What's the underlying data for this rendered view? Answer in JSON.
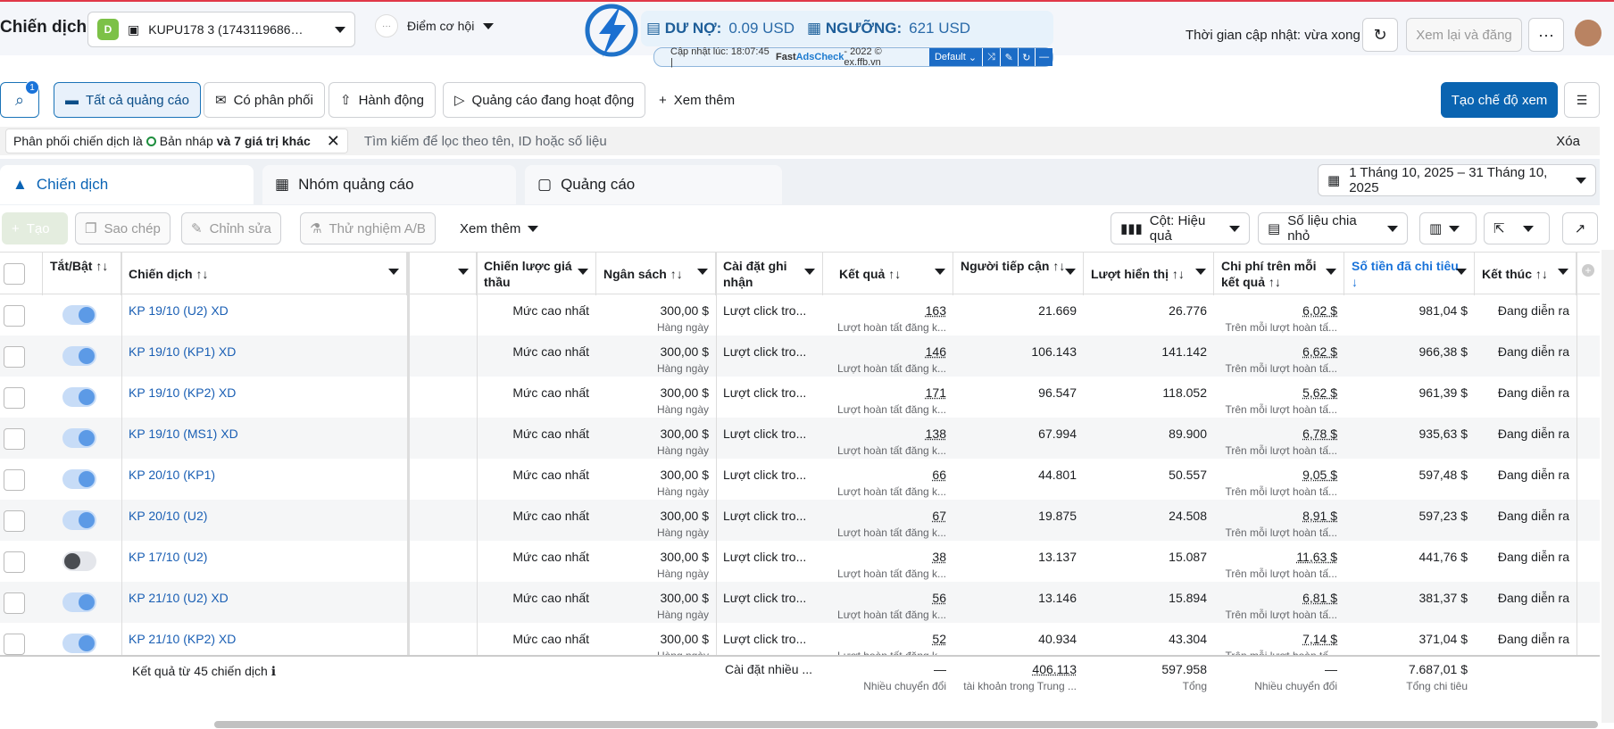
{
  "header": {
    "title": "Chiến dịch",
    "account_badge": "D",
    "account": "KUPU178 3 (1743119686…",
    "opportunity_dots": "···",
    "opportunity": "Điểm cơ hội",
    "update_text": "Thời gian cập nhật: vừa xong",
    "review": "Xem lại và đăng",
    "more": "···"
  },
  "extension": {
    "debt_label": "DƯ NỢ:",
    "debt": "0.09 USD",
    "threshold_label": "NGƯỠNG:",
    "threshold": "621 USD",
    "update_time": "Cập nhật lúc: 18:07:45 | ",
    "brand_fast": "Fast ",
    "brand_ads": "AdsCheck",
    "brand_rest": " - 2022 © ex.ffb.vn",
    "mode": "Default"
  },
  "filters": {
    "search_badge": "1",
    "all_ads": "Tất cả quảng cáo",
    "delivered": "Có phân phối",
    "actions": "Hành động",
    "active_ads": "Quảng cáo đang hoạt động",
    "see_more": "Xem thêm",
    "create_view": "Tạo chế độ xem"
  },
  "filter_bar": {
    "chip_prefix": "Phân phối chiến dịch là",
    "chip_value": "Bản nháp",
    "chip_more": "và 7 giá trị khác",
    "search_placeholder": "Tìm kiếm để lọc theo tên, ID hoặc số liệu",
    "clear": "Xóa"
  },
  "tabs": [
    "Chiến dịch",
    "Nhóm quảng cáo",
    "Quảng cáo"
  ],
  "date_range": "1 Tháng 10, 2025 – 31 Tháng 10, 2025",
  "toolbar": {
    "create": "Tạo",
    "copy": "Sao chép",
    "edit": "Chỉnh sửa",
    "ab_test": "Thử nghiệm A/B",
    "more": "Xem thêm",
    "columns": "Cột: Hiệu quả",
    "breakdown": "Số liệu chia nhỏ"
  },
  "columns": {
    "toggle": "Tắt/Bật ↑↓",
    "campaign": "Chiến dịch ↑↓",
    "bid": "Chiến lược giá thầu",
    "budget": "Ngân sách ↑↓",
    "attribution": "Cài đặt ghi nhận",
    "results": "Kết quả ↑↓",
    "reach": "Người tiếp cận ↑↓",
    "impressions": "Lượt hiển thị ↑↓",
    "cpr": "Chi phí trên mỗi kết quả ↑↓",
    "spent": "Số tiền đã chi tiêu ↓",
    "end": "Kết thúc ↑↓"
  },
  "rows": [
    {
      "on": true,
      "name": "KP 19/10 (U2) XD",
      "bid": "Mức cao nhất",
      "budget": "300,00 $",
      "budget_sub": "Hàng ngày",
      "attr": "Lượt click tro...",
      "res": "163",
      "res_sub": "Lượt hoàn tất đăng k...",
      "reach": "21.669",
      "imp": "26.776",
      "cpr": "6,02 $",
      "cpr_sub": "Trên mỗi lượt hoàn tấ...",
      "spent": "981,04 $",
      "end": "Đang diễn ra"
    },
    {
      "on": true,
      "name": "KP 19/10 (KP1) XD",
      "bid": "Mức cao nhất",
      "budget": "300,00 $",
      "budget_sub": "Hàng ngày",
      "attr": "Lượt click tro...",
      "res": "146",
      "res_sub": "Lượt hoàn tất đăng k...",
      "reach": "106.143",
      "imp": "141.142",
      "cpr": "6,62 $",
      "cpr_sub": "Trên mỗi lượt hoàn tấ...",
      "spent": "966,38 $",
      "end": "Đang diễn ra"
    },
    {
      "on": true,
      "name": "KP 19/10 (KP2) XD",
      "bid": "Mức cao nhất",
      "budget": "300,00 $",
      "budget_sub": "Hàng ngày",
      "attr": "Lượt click tro...",
      "res": "171",
      "res_sub": "Lượt hoàn tất đăng k...",
      "reach": "96.547",
      "imp": "118.052",
      "cpr": "5,62 $",
      "cpr_sub": "Trên mỗi lượt hoàn tấ...",
      "spent": "961,39 $",
      "end": "Đang diễn ra"
    },
    {
      "on": true,
      "name": "KP 19/10 (MS1) XD",
      "bid": "Mức cao nhất",
      "budget": "300,00 $",
      "budget_sub": "Hàng ngày",
      "attr": "Lượt click tro...",
      "res": "138",
      "res_sub": "Lượt hoàn tất đăng k...",
      "reach": "67.994",
      "imp": "89.900",
      "cpr": "6,78 $",
      "cpr_sub": "Trên mỗi lượt hoàn tấ...",
      "spent": "935,63 $",
      "end": "Đang diễn ra"
    },
    {
      "on": true,
      "name": "KP 20/10 (KP1)",
      "bid": "Mức cao nhất",
      "budget": "300,00 $",
      "budget_sub": "Hàng ngày",
      "attr": "Lượt click tro...",
      "res": "66",
      "res_sub": "Lượt hoàn tất đăng k...",
      "reach": "44.801",
      "imp": "50.557",
      "cpr": "9,05 $",
      "cpr_sub": "Trên mỗi lượt hoàn tấ...",
      "spent": "597,48 $",
      "end": "Đang diễn ra"
    },
    {
      "on": true,
      "name": "KP 20/10 (U2)",
      "bid": "Mức cao nhất",
      "budget": "300,00 $",
      "budget_sub": "Hàng ngày",
      "attr": "Lượt click tro...",
      "res": "67",
      "res_sub": "Lượt hoàn tất đăng k...",
      "reach": "19.875",
      "imp": "24.508",
      "cpr": "8,91 $",
      "cpr_sub": "Trên mỗi lượt hoàn tấ...",
      "spent": "597,23 $",
      "end": "Đang diễn ra"
    },
    {
      "on": false,
      "name": "KP 17/10 (U2)",
      "bid": "Mức cao nhất",
      "budget": "300,00 $",
      "budget_sub": "Hàng ngày",
      "attr": "Lượt click tro...",
      "res": "38",
      "res_sub": "Lượt hoàn tất đăng k...",
      "reach": "13.137",
      "imp": "15.087",
      "cpr": "11,63 $",
      "cpr_sub": "Trên mỗi lượt hoàn tấ...",
      "spent": "441,76 $",
      "end": "Đang diễn ra"
    },
    {
      "on": true,
      "name": "KP 21/10 (U2) XD",
      "bid": "Mức cao nhất",
      "budget": "300,00 $",
      "budget_sub": "Hàng ngày",
      "attr": "Lượt click tro...",
      "res": "56",
      "res_sub": "Lượt hoàn tất đăng k...",
      "reach": "13.146",
      "imp": "15.894",
      "cpr": "6,81 $",
      "cpr_sub": "Trên mỗi lượt hoàn tấ...",
      "spent": "381,37 $",
      "end": "Đang diễn ra"
    },
    {
      "on": true,
      "name": "KP 21/10 (KP2) XD",
      "bid": "Mức cao nhất",
      "budget": "300,00 $",
      "budget_sub": "Hàng ngày",
      "attr": "Lượt click tro...",
      "res": "52",
      "res_sub": "Lượt hoàn tất đăng k...",
      "reach": "40.934",
      "imp": "43.304",
      "cpr": "7,14 $",
      "cpr_sub": "Trên mỗi lượt hoàn tấ...",
      "spent": "371,04 $",
      "end": "Đang diễn ra"
    }
  ],
  "totals": {
    "label": "Kết quả từ 45 chiến dịch",
    "attr": "Cài đặt nhiều ...",
    "res": "—",
    "res_sub": "Nhiều chuyển đổi",
    "reach": "406.113",
    "reach_sub": "tài khoản trong Trung ...",
    "imp": "597.958",
    "imp_sub": "Tổng",
    "cpr": "—",
    "cpr_sub": "Nhiều chuyển đổi",
    "spent": "7.687,01 $",
    "spent_sub": "Tổng chi tiêu"
  },
  "colors": {
    "accent": "#0a64b1",
    "link": "#1a5fb4",
    "toggle_on": "#5c9ae6"
  }
}
